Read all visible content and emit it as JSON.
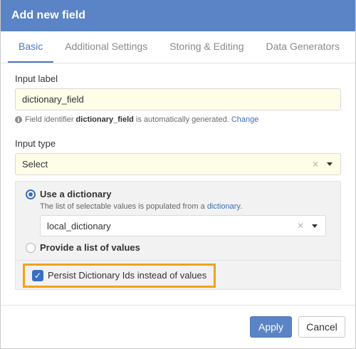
{
  "dialog": {
    "title": "Add new field"
  },
  "tabs": [
    {
      "label": "Basic",
      "active": true
    },
    {
      "label": "Additional Settings"
    },
    {
      "label": "Storing & Editing"
    },
    {
      "label": "Data Generators"
    }
  ],
  "input_label": {
    "label": "Input label",
    "value": "dictionary_field"
  },
  "hint": {
    "prefix": "Field identifier",
    "identifier": "dictionary_field",
    "suffix": "is automatically generated.",
    "change_link": "Change"
  },
  "input_type": {
    "label": "Input type",
    "value": "Select"
  },
  "options": {
    "use_dictionary": {
      "label": "Use a dictionary",
      "checked": true,
      "hint_prefix": "The list of selectable values is populated from a",
      "hint_link": "dictionary",
      "hint_suffix": ".",
      "selected_dictionary": "local_dictionary"
    },
    "provide_list": {
      "label": "Provide a list of values",
      "checked": false
    }
  },
  "persist": {
    "label": "Persist Dictionary Ids instead of values",
    "checked": true
  },
  "footer": {
    "apply_label": "Apply",
    "cancel_label": "Cancel"
  },
  "icons": {
    "info": "info-icon",
    "clear": "close-icon",
    "caret": "chevron-down-icon",
    "check": "checkmark-icon"
  },
  "colors": {
    "header": "#5b84c7",
    "accent": "#4a78c2",
    "highlight": "#f0a21c",
    "input_bg": "#fdfde8"
  }
}
